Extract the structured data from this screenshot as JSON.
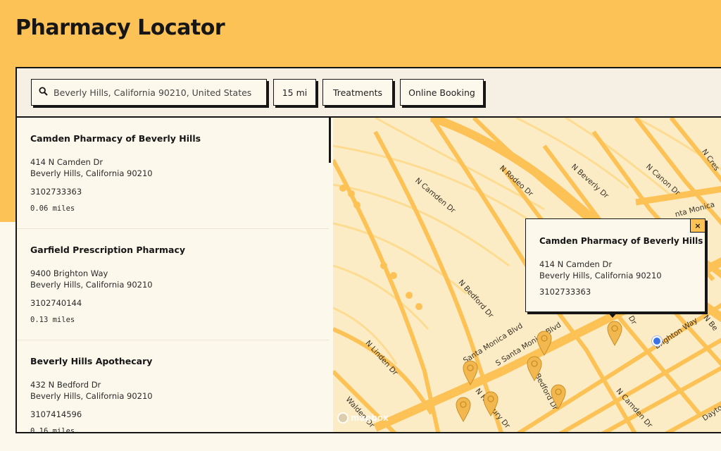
{
  "page": {
    "title": "Pharmacy Locator"
  },
  "toolbar": {
    "search_value": "Beverly Hills, California 90210, United States",
    "radius_label": "15 mi",
    "treatments_label": "Treatments",
    "booking_label": "Online Booking"
  },
  "results": [
    {
      "name": "Camden Pharmacy of Beverly Hills",
      "address_line1": "414 N Camden Dr",
      "address_line2": "Beverly Hills, California 90210",
      "phone": "3102733363",
      "distance": "0.06 miles"
    },
    {
      "name": "Garfield Prescription Pharmacy",
      "address_line1": "9400 Brighton Way",
      "address_line2": "Beverly Hills, California 90210",
      "phone": "3102740144",
      "distance": "0.13 miles"
    },
    {
      "name": "Beverly Hills Apothecary",
      "address_line1": "432 N Bedford Dr",
      "address_line2": "Beverly Hills, California 90210",
      "phone": "3107414596",
      "distance": "0.16 miles"
    }
  ],
  "map": {
    "streets": [
      "N Rodeo Dr",
      "N Beverly Dr",
      "N Canon Dr",
      "N Cres",
      "N Camden Dr",
      "N Bedford Dr",
      "Santa Monica Blvd",
      "S Santa Monica Blvd",
      "N Linden Dr",
      "Walden Dr",
      "Brighton Way",
      "Dayton",
      "N Bedford Dr",
      "N Roxbury Dr",
      "N Camden Dr",
      "Dr",
      "nta Monica",
      "N Be"
    ],
    "popup": {
      "name": "Camden Pharmacy of Beverly Hills",
      "address_line1": "414 N Camden Dr",
      "address_line2": "Beverly Hills, California 90210",
      "phone": "3102733363",
      "close_label": "×"
    },
    "attribution": "mapbox"
  },
  "colors": {
    "brand": "#fdc255",
    "road": "#fdc255",
    "map_bg": "#fcecc6",
    "pin": "#f2b84f",
    "user_location": "#3b73e6"
  },
  "icons": {
    "search": "search-icon",
    "pin": "map-pin-icon",
    "close": "close-icon",
    "user": "user-location-icon"
  }
}
